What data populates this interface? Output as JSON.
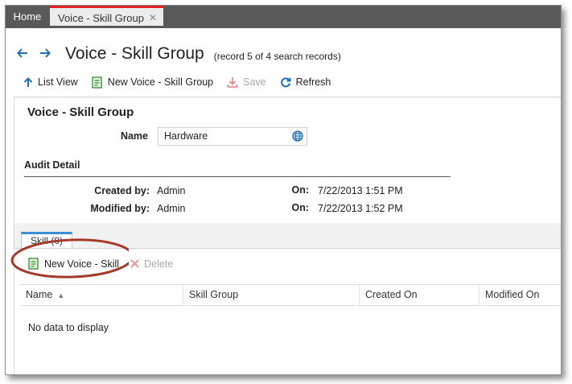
{
  "tabs": {
    "home_label": "Home",
    "active_label": "Voice - Skill Group",
    "close_glyph": "✕"
  },
  "header": {
    "title": "Voice - Skill Group",
    "record_info": "(record 5 of 4 search records)",
    "back_icon": "arrow-left-icon",
    "forward_icon": "arrow-right-icon"
  },
  "toolbar": {
    "list_view": "List View",
    "new_label": "New Voice - Skill Group",
    "save_label": "Save",
    "refresh_label": "Refresh"
  },
  "form": {
    "section_title": "Voice - Skill Group",
    "name_label": "Name",
    "name_value": "Hardware",
    "audit_title": "Audit Detail",
    "created_by_label": "Created by:",
    "created_by_value": "Admin",
    "created_on_label": "On:",
    "created_on_value": "7/22/2013 1:51 PM",
    "modified_by_label": "Modified by:",
    "modified_by_value": "Admin",
    "modified_on_label": "On:",
    "modified_on_value": "7/22/2013 1:52 PM"
  },
  "grid": {
    "subtab_label": "Skill (0)",
    "new_label": "New Voice - Skill",
    "delete_label": "Delete",
    "columns": [
      "Name",
      "Skill Group",
      "Created On",
      "Modified On"
    ],
    "empty_text": "No data to display"
  },
  "colors": {
    "accent_blue": "#1f6fb5",
    "active_tab_red": "#e02020",
    "annotation_oval": "#a33a2a",
    "new_icon_green": "#2e8b2e"
  }
}
